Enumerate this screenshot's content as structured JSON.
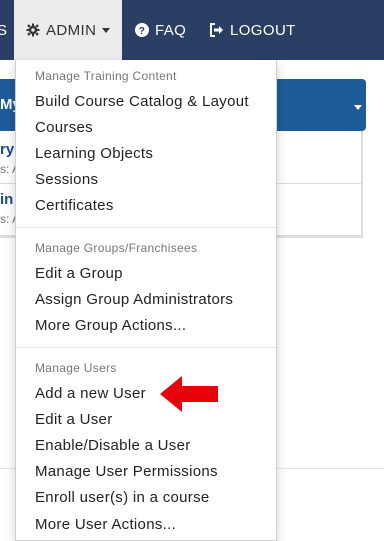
{
  "navbar": {
    "left_edge_label": "S",
    "admin_label": "ADMIN",
    "faq_label": "FAQ",
    "logout_label": "LOGOUT"
  },
  "background": {
    "panel_title": "My",
    "rows": [
      {
        "title": "ry",
        "sub": "s: A"
      },
      {
        "title": "in",
        "sub": "s: A"
      }
    ]
  },
  "dropdown": {
    "sections": [
      {
        "header": "Manage Training Content",
        "items": [
          "Build Course Catalog & Layout",
          "Courses",
          "Learning Objects",
          "Sessions",
          "Certificates"
        ]
      },
      {
        "header": "Manage Groups/Franchisees",
        "items": [
          "Edit a Group",
          "Assign Group Administrators",
          "More Group Actions..."
        ]
      },
      {
        "header": "Manage Users",
        "items": [
          "Add a new User",
          "Edit a User",
          "Enable/Disable a User",
          "Manage User Permissions",
          "Enroll user(s) in a course",
          "More User Actions..."
        ]
      }
    ]
  },
  "annotation": {
    "color": "#e8000b",
    "icon": "red-arrow-left-icon"
  },
  "colors": {
    "navbar": "#2a3f63",
    "panel": "#1e5c99",
    "link": "#1a4d8c"
  }
}
